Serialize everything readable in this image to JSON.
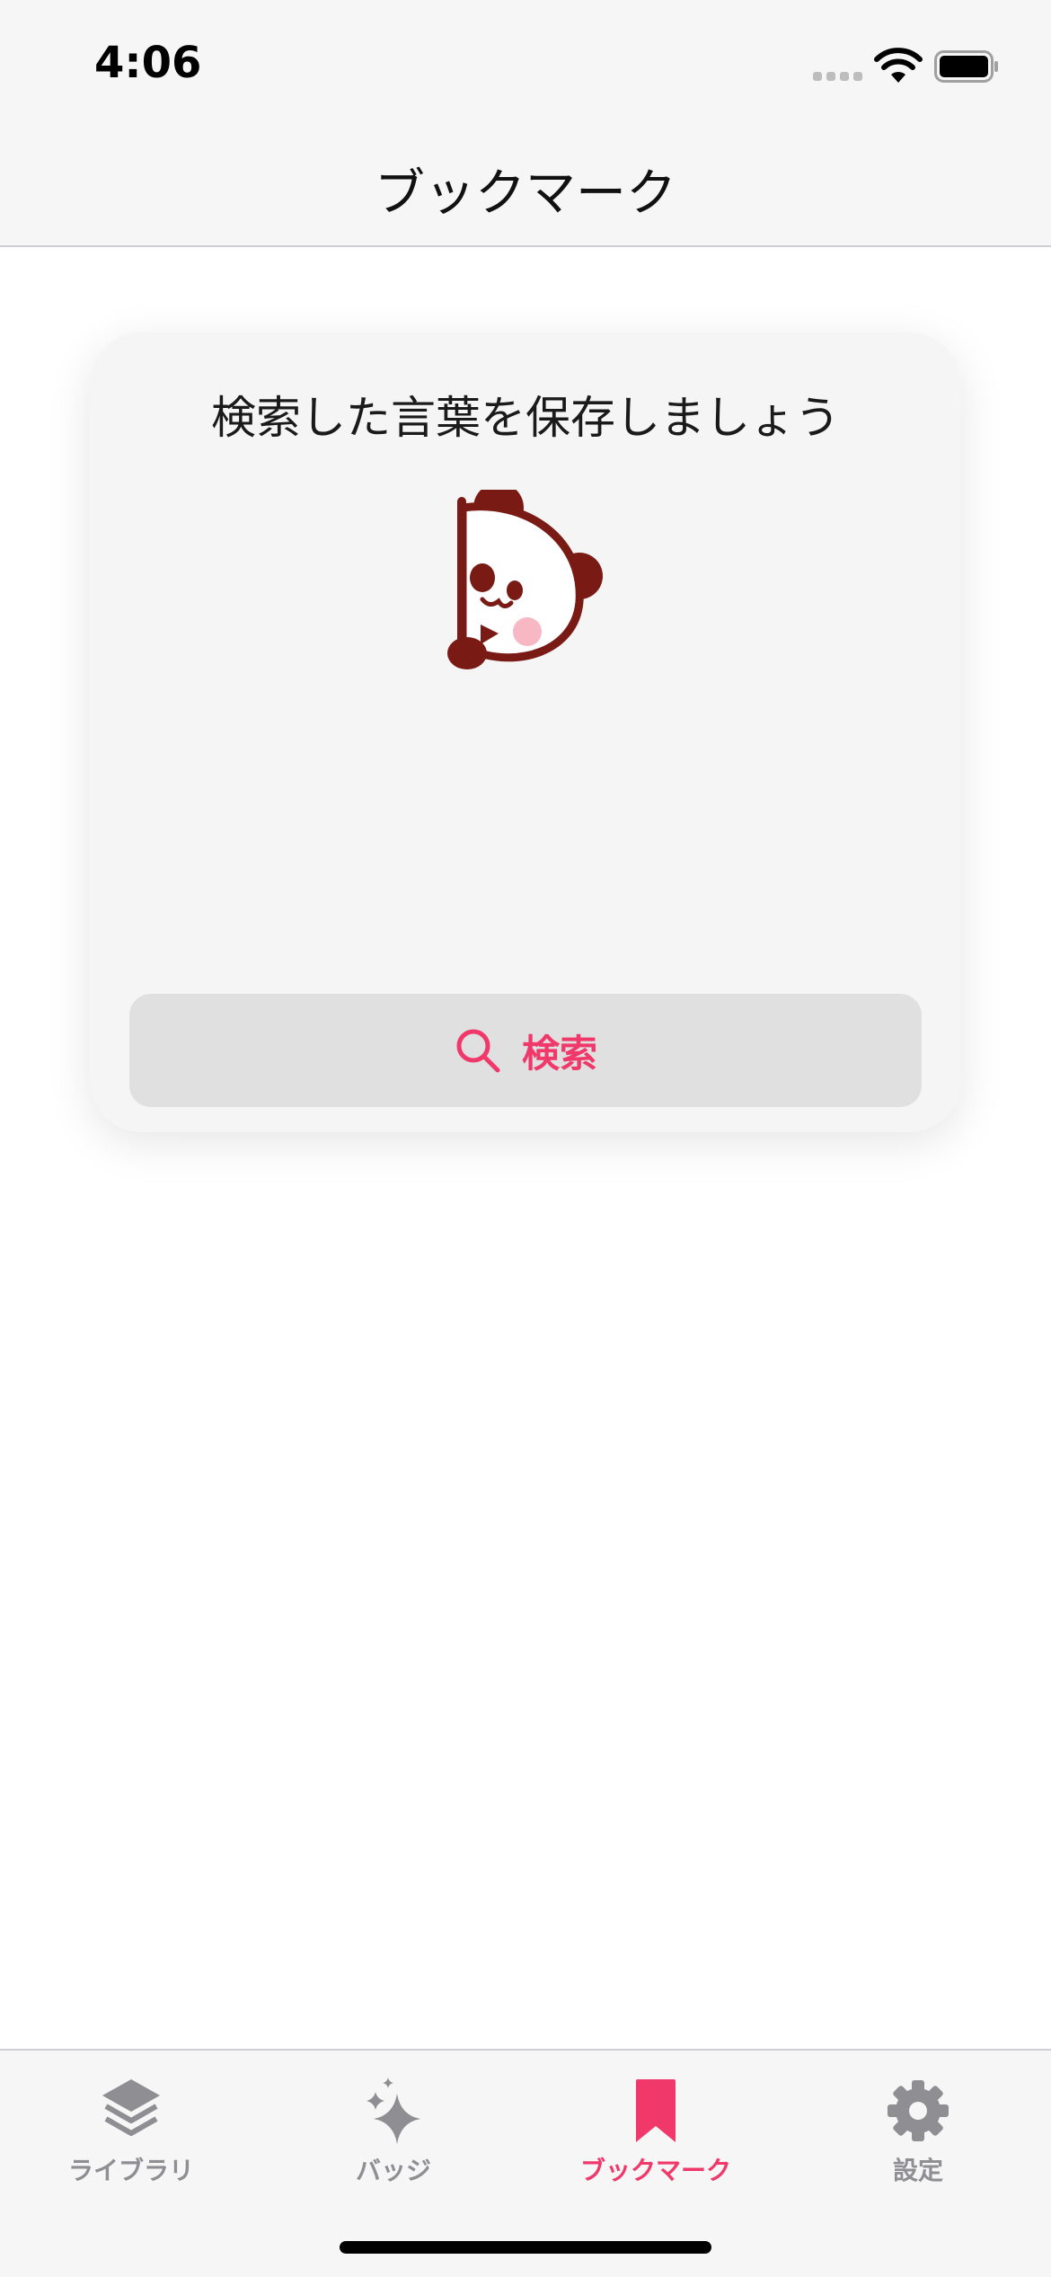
{
  "status_bar": {
    "time": "4:06"
  },
  "nav": {
    "title": "ブックマーク"
  },
  "card": {
    "title": "検索した言葉を保存しましょう",
    "illustration": "panda-icon",
    "search_button": {
      "label": "検索",
      "icon": "search-icon"
    }
  },
  "tabs": [
    {
      "label": "ライブラリ",
      "icon": "layers-icon",
      "active": false
    },
    {
      "label": "バッジ",
      "icon": "sparkles-icon",
      "active": false
    },
    {
      "label": "ブックマーク",
      "icon": "bookmark-icon",
      "active": true
    },
    {
      "label": "設定",
      "icon": "gear-icon",
      "active": false
    }
  ],
  "colors": {
    "accent": "#f0386a",
    "inactive": "#8e8e93",
    "panda": "#7a1a14",
    "cheek": "#f7b7c3"
  }
}
